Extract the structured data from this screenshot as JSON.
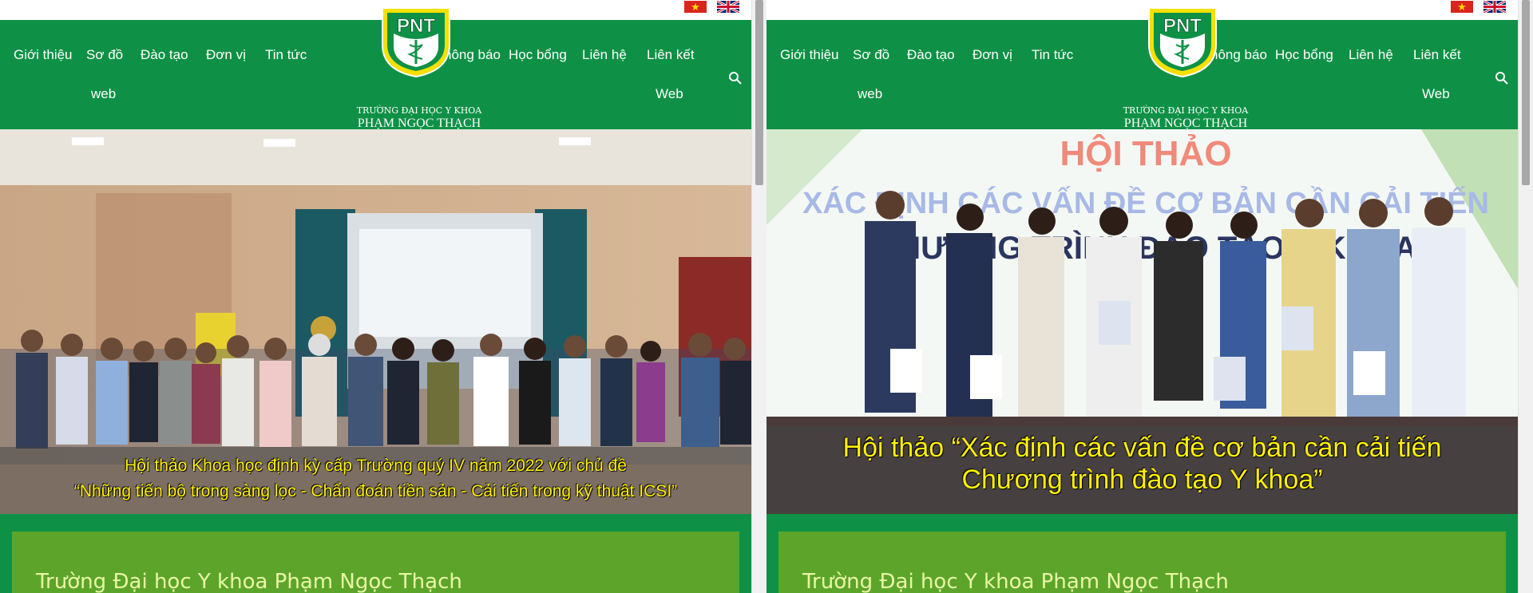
{
  "header": {
    "flags": [
      "vn-flag-icon",
      "uk-flag-icon"
    ],
    "nav": {
      "gioi_thieu": "Giới thiệu",
      "so_do": "Sơ đồ",
      "so_do_web": "web",
      "dao_tao": "Đào tạo",
      "don_vi": "Đơn vị",
      "tin_tuc": "Tin tức",
      "thong_bao": "hông báo",
      "hoc_bong": "Học bổng",
      "lien_he": "Liên hệ",
      "lien_ket": "Liên kết",
      "lien_ket_web": "Web"
    },
    "logo": {
      "text": "PNT",
      "ring_text": "TRƯỜNG ĐẠI HỌC Y KHOA PHẠM NGỌC THẠCH"
    },
    "school_small": "TRƯỜNG ĐẠI HỌC Y KHOA",
    "school_big": "PHẠM NGỌC THẠCH",
    "search_icon": "search-icon"
  },
  "left": {
    "caption_line1": "Hội thảo Khoa học định kỳ cấp Trường quý IV năm 2022 với chủ đề",
    "caption_line2": "“Những tiến bộ trong sàng lọc - Chẩn đoán tiền sản - Cải tiến trong kỹ thuật ICSI”",
    "card_title": "Trường Đại học Y khoa Phạm Ngọc Thạch"
  },
  "right": {
    "slide_title": "HỘI THẢO",
    "slide_line1": "XÁC ĐỊNH CÁC VẤN ĐỀ CƠ BẢN CẦN CẢI TIẾN",
    "slide_line2": "CHƯƠNG TRÌNH ĐÀO TẠO Y KHOA",
    "caption_line1": "Hội thảo “Xác định các vấn đề cơ bản cần cải tiến",
    "caption_line2": "Chương trình đào tạo Y khoa”",
    "card_title": "Trường Đại học Y khoa Phạm Ngọc Thạch"
  },
  "colors": {
    "nav_green": "#0e9146",
    "card_green": "#5ca52a",
    "caption_yellow": "#fff200",
    "slide_title": "#f08a7a",
    "slide_line1": "#a8b9e6",
    "slide_line2": "#2b3560"
  }
}
